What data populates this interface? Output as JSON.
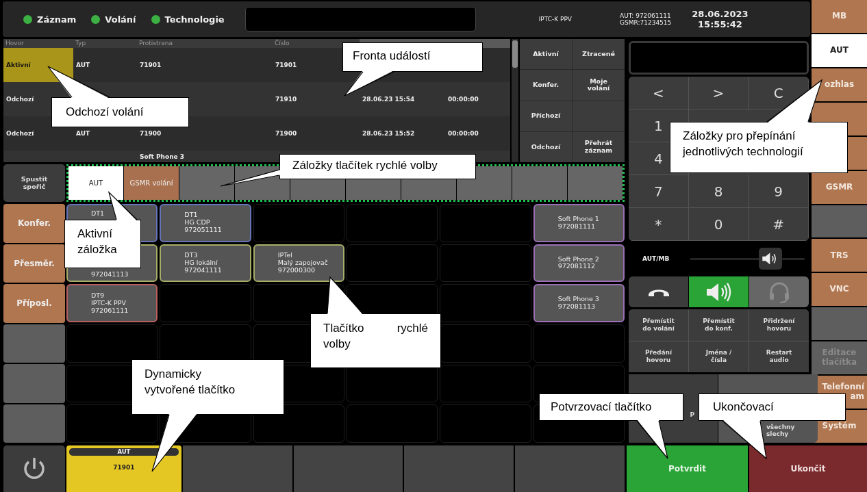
{
  "status_indicators": [
    {
      "label": "Záznam",
      "color": "#3cb043"
    },
    {
      "label": "Volání",
      "color": "#3cb043"
    },
    {
      "label": "Technologie",
      "color": "#3cb043"
    }
  ],
  "top_bar": {
    "location": "IPTC-K PPV",
    "numbers": [
      "AUT: 972061111",
      "GSMR:71234515"
    ],
    "date": "28.06.2023",
    "time": "15:55:42"
  },
  "call_table": {
    "columns": [
      "Hovor",
      "Typ",
      "Protistrana",
      "Číslo"
    ],
    "rows": [
      {
        "selected": true,
        "call": "Aktivní",
        "type": "AUT",
        "party": "71901",
        "number": "71901"
      },
      {
        "selected": false,
        "call": "Odchozí",
        "number": "71910",
        "time": "28.06.23 15:54",
        "duration": "00:00:00"
      },
      {
        "selected": false,
        "call": "Odchozí",
        "type": "AUT",
        "party": "71900",
        "number": "71900",
        "time": "28.06.23 15:52",
        "duration": "00:00:00"
      },
      {
        "selected": false,
        "party": "Soft Phone 3"
      }
    ]
  },
  "call_filters": [
    [
      {
        "kind": "filter",
        "label": "Aktivní"
      },
      {
        "kind": "filter",
        "label": "Ztracené"
      }
    ],
    [
      {
        "kind": "filter",
        "label": "Konfer."
      },
      {
        "kind": "filter",
        "label": "Moje\nvolání"
      }
    ],
    [
      {
        "kind": "filter",
        "label": "Příchozí"
      },
      {
        "kind": "blank"
      }
    ],
    [
      {
        "kind": "filter",
        "label": "Odchozí"
      },
      {
        "kind": "filter",
        "label": "Přehrát\nzáznam"
      }
    ]
  ],
  "screensaver_button": "Spustit\nspořič",
  "speed_dial_tabs": [
    {
      "label": "AUT",
      "selected": true
    },
    {
      "label": "GSMR volání",
      "selected": false
    },
    {
      "selected": false
    },
    {
      "selected": false
    },
    {
      "selected": false
    },
    {
      "selected": false
    },
    {
      "selected": false
    },
    {
      "selected": false
    },
    {
      "selected": false
    },
    {
      "selected": false
    }
  ],
  "side_actions": [
    {
      "kind": "action",
      "label": "Konfer."
    },
    {
      "kind": "action",
      "label": "Přesměr."
    },
    {
      "kind": "action",
      "label": "Příposl."
    },
    {
      "kind": "blank"
    },
    {
      "kind": "blank"
    },
    {
      "kind": "blank"
    }
  ],
  "speed_dial": [
    [
      {
        "kind": "button_top",
        "color": "#6673b8",
        "lines": [
          "DT1"
        ]
      },
      {
        "kind": "button",
        "color": "#6673b8",
        "lines": [
          "DT1",
          "HG CDP",
          "972051111"
        ]
      },
      {
        "kind": "empty"
      },
      {
        "kind": "empty"
      },
      {
        "kind": "empty"
      },
      {
        "kind": "button",
        "color": "#9a6fb5",
        "lines": [
          "Soft Phone 1",
          "972081111"
        ]
      }
    ],
    [
      {
        "kind": "button_bottom",
        "color": "#a6ad66",
        "lines": [
          "972041113"
        ]
      },
      {
        "kind": "button",
        "color": "#a6ad66",
        "lines": [
          "DT3",
          "HG lokální",
          "972041111"
        ]
      },
      {
        "kind": "button",
        "color": "#a6ad66",
        "lines": [
          "IPTel",
          "Malý zapojovač",
          "972000300"
        ]
      },
      {
        "kind": "empty"
      },
      {
        "kind": "empty"
      },
      {
        "kind": "button",
        "color": "#9a6fb5",
        "lines": [
          "Soft Phone 2",
          "972081112"
        ]
      }
    ],
    [
      {
        "kind": "button",
        "color": "#b86060",
        "lines": [
          "DT9",
          "IPTC-K PPV",
          "972061111"
        ]
      },
      {
        "kind": "empty"
      },
      {
        "kind": "empty"
      },
      {
        "kind": "empty"
      },
      {
        "kind": "empty"
      },
      {
        "kind": "button",
        "color": "#9a6fb5",
        "lines": [
          "Soft Phone 3",
          "972081113"
        ]
      }
    ],
    [
      {
        "kind": "empty"
      },
      {
        "kind": "empty"
      },
      {
        "kind": "empty"
      },
      {
        "kind": "covered"
      },
      {
        "kind": "empty"
      },
      {
        "kind": "empty"
      }
    ],
    [
      {
        "kind": "empty"
      },
      {
        "kind": "covered"
      },
      {
        "kind": "empty"
      },
      {
        "kind": "empty"
      },
      {
        "kind": "empty"
      },
      {
        "kind": "empty"
      }
    ],
    [
      {
        "kind": "empty"
      },
      {
        "kind": "empty"
      },
      {
        "kind": "empty"
      },
      {
        "kind": "empty"
      },
      {
        "kind": "empty"
      },
      {
        "kind": "empty"
      }
    ]
  ],
  "dynamic_buttons": [
    {
      "kind": "call",
      "tag": "AUT",
      "number": "71901"
    },
    {
      "kind": "blank"
    },
    {
      "kind": "blank"
    },
    {
      "kind": "blank"
    },
    {
      "kind": "blank"
    }
  ],
  "keypad": [
    [
      "<",
      ">",
      "C"
    ],
    [
      "1"
    ],
    [
      "4"
    ],
    [
      "7",
      "8",
      "9"
    ],
    [
      "*",
      "0",
      "#"
    ]
  ],
  "volume": {
    "label": "AUT/MB",
    "level": 0.7
  },
  "audio_modes": [
    {
      "kind": "handset",
      "selected": false,
      "disabled": false
    },
    {
      "kind": "speaker",
      "selected": true,
      "disabled": false
    },
    {
      "kind": "headset",
      "selected": false,
      "disabled": true
    }
  ],
  "call_functions": [
    {
      "label": "Přemístit\ndo volání"
    },
    {
      "label": "Přemístit\ndo konf."
    },
    {
      "label": "Přidržení\nhovoru"
    },
    {
      "label": "Předání\nhovoru"
    },
    {
      "label": "Jména /\nčísla"
    },
    {
      "label": "Restart\naudio"
    }
  ],
  "extra_functions": [
    {
      "label": "P"
    },
    {
      "label": "všechny\nslechy"
    }
  ],
  "technology_tabs": [
    {
      "kind": "tech",
      "label": "MB",
      "selected": false,
      "disabled": false
    },
    {
      "kind": "tech",
      "label": "AUT",
      "selected": true,
      "disabled": false
    },
    {
      "kind": "tech",
      "label": "ozhlas",
      "selected": false,
      "disabled": false
    },
    {
      "kind": "tech",
      "selected": false,
      "disabled": false
    },
    {
      "kind": "tech",
      "selected": false,
      "disabled": false
    },
    {
      "kind": "tech",
      "label": "GSMR",
      "selected": false,
      "disabled": false
    },
    {
      "kind": "blank"
    },
    {
      "kind": "tech",
      "label": "TRS",
      "selected": false,
      "disabled": false
    },
    {
      "kind": "tech",
      "label": "VNC",
      "selected": false,
      "disabled": false
    },
    {
      "kind": "blank"
    },
    {
      "kind": "tech",
      "label": "Editace\ntlačítka",
      "selected": false,
      "disabled": true
    },
    {
      "kind": "tech_right",
      "label": "Telefonní\nam",
      "selected": false,
      "disabled": false
    },
    {
      "kind": "tech",
      "label": "Systém",
      "selected": false,
      "disabled": false
    }
  ],
  "confirm_button": "Potvrdit",
  "end_button": "Ukončit",
  "callouts": [
    {
      "text": "Fronta událostí"
    },
    {
      "text": "Odchozí volání"
    },
    {
      "text": "Záložky tlačítek rychlé volby"
    },
    {
      "text": "Aktivní záložka"
    },
    {
      "text": "Tlačítko rychlé volby"
    },
    {
      "text": "Dynamicky vytvořené tlačítko"
    },
    {
      "text": "Záložky pro přepínání jednotlivých technologií"
    },
    {
      "text": "Potvrzovací tlačítko"
    },
    {
      "text": "Ukončovací"
    }
  ]
}
